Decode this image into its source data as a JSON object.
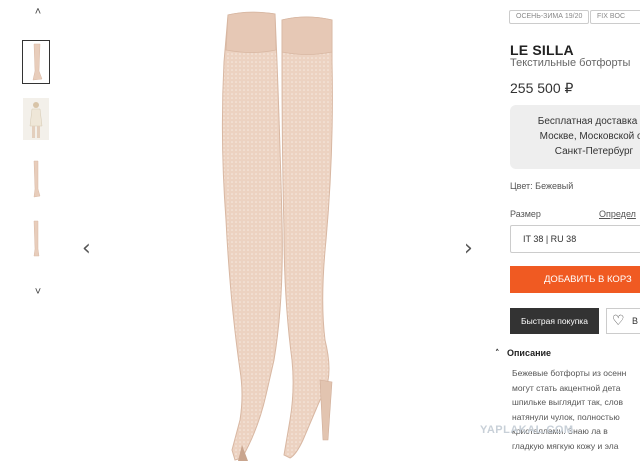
{
  "gallery": {
    "arrow_up": "˄",
    "arrow_down": "˅",
    "prev": "‹",
    "next": "›"
  },
  "badges": {
    "season": "ОСЕНЬ-ЗИМА 19/20",
    "fix": "FIX BOC"
  },
  "product": {
    "brand": "LE SILLA",
    "subtitle": "Текстильные ботфорты",
    "price": "255 500 ₽"
  },
  "delivery": {
    "lines": [
      "Бесплатная доставка за",
      "Москве, Московской об",
      "Санкт-Петербург"
    ]
  },
  "color_text": "Цвет: Бежевый",
  "size": {
    "label": "Размер",
    "table_link": "Определ",
    "selected": "IT 38 | RU 38"
  },
  "buttons": {
    "add_to_cart": "ДОБАВИТЬ В КОРЗ",
    "quick_buy": "Быстрая покупка",
    "wishlist": "В"
  },
  "description": {
    "heading": "Описание",
    "lines": [
      "Бежевые ботфорты из осенн",
      "могут стать акцентной дета",
      "шпильке выглядит так, слов",
      "натянули чулок, полностью",
      "кристаллами. Знаю ла в",
      "гладкую мягкую кожу и эла"
    ]
  },
  "watermark": "YAPLAKAL.COM",
  "colors": {
    "accent": "#f05a22",
    "dark_button": "#333333",
    "delivery_bg": "#eeeeee",
    "boot": "#e8cdbb"
  }
}
